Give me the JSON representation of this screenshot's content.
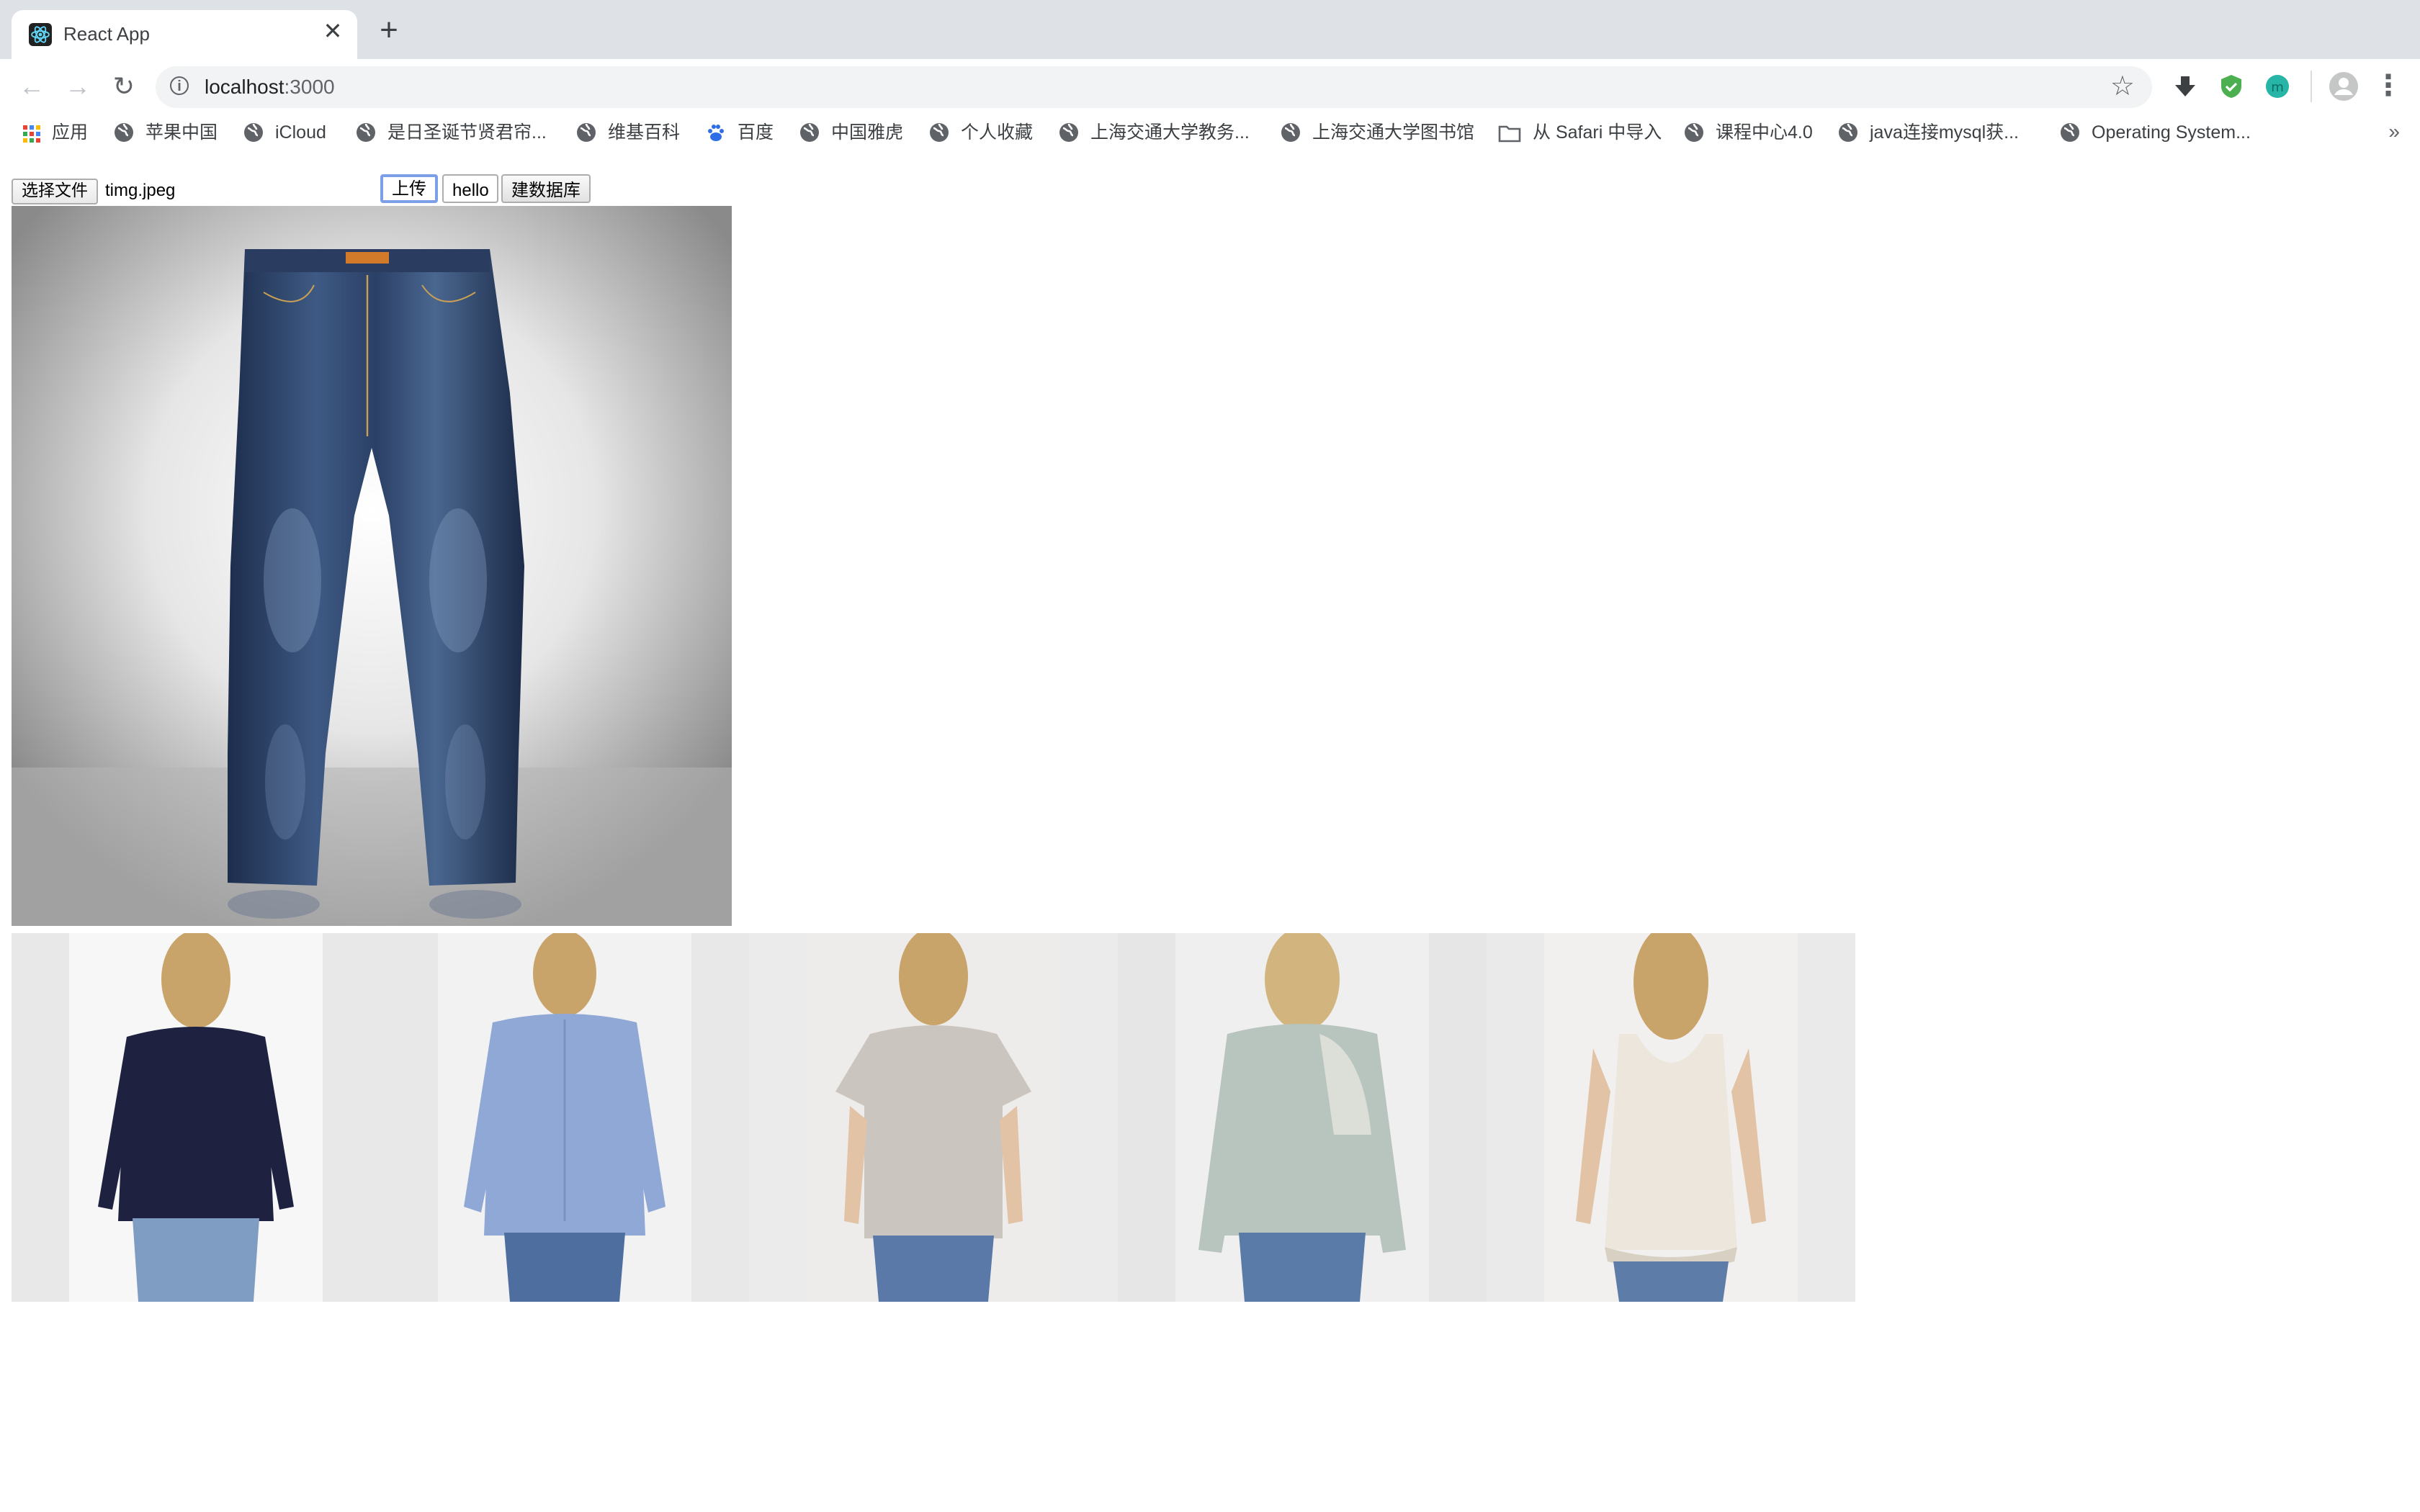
{
  "browser": {
    "tab_title": "React App",
    "tab_close": "✕",
    "new_tab": "+",
    "url_host": "localhost",
    "url_port": ":3000",
    "bookmarks": [
      {
        "label": "应用",
        "icon": "apps-grid-icon"
      },
      {
        "label": "苹果中国",
        "icon": "globe-icon"
      },
      {
        "label": "iCloud",
        "icon": "globe-icon"
      },
      {
        "label": "是日圣诞节贤君帘...",
        "icon": "globe-icon"
      },
      {
        "label": "维基百科",
        "icon": "globe-icon"
      },
      {
        "label": "百度",
        "icon": "baidu-paw-icon"
      },
      {
        "label": "中国雅虎",
        "icon": "globe-icon"
      },
      {
        "label": "个人收藏",
        "icon": "globe-icon"
      },
      {
        "label": "上海交通大学教务...",
        "icon": "globe-icon"
      },
      {
        "label": "上海交通大学图书馆",
        "icon": "globe-icon"
      },
      {
        "label": "从 Safari 中导入",
        "icon": "folder-icon"
      },
      {
        "label": "课程中心4.0",
        "icon": "globe-icon"
      },
      {
        "label": "java连接mysql获...",
        "icon": "globe-icon"
      },
      {
        "label": "Operating System...",
        "icon": "globe-icon"
      }
    ],
    "bookmarks_more": "»"
  },
  "page": {
    "file_button": "选择文件",
    "file_name": "timg.jpeg",
    "upload_button": "上传",
    "hello_button": "hello",
    "build_db_button": "建数据库",
    "main_image": "jeans-photo",
    "results": [
      {
        "item": "navy-long-sleeve-top",
        "color": "#1e2240"
      },
      {
        "item": "light-blue-shirt",
        "color": "#8fa8d6"
      },
      {
        "item": "grey-tshirt",
        "color": "#cbc5bf"
      },
      {
        "item": "mint-lace-sweater",
        "color": "#b8c4be"
      },
      {
        "item": "white-lace-tank",
        "color": "#ece6dc"
      }
    ]
  },
  "colors": {
    "tabstrip": "#dee1e6",
    "omnibox": "#f1f3f4",
    "focus_ring": "#7c9fe8"
  }
}
